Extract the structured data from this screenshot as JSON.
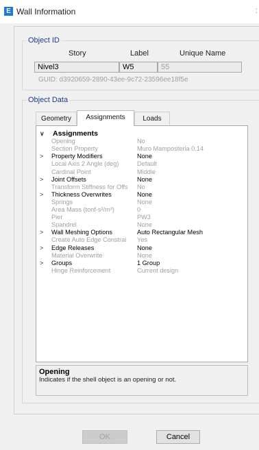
{
  "window": {
    "title": "Wall Information",
    "app_icon": "E"
  },
  "object_id": {
    "group_title": "Object ID",
    "headers": {
      "story": "Story",
      "label": "Label",
      "unique_name": "Unique Name"
    },
    "values": {
      "story": "Nivel3",
      "label": "W5",
      "unique_name": "55"
    },
    "guid": "GUID:  d3920659-2890-43ee-9c72-23596ee18f5e"
  },
  "object_data": {
    "group_title": "Object Data",
    "tabs": [
      {
        "label": "Geometry",
        "active": false
      },
      {
        "label": "Assignments",
        "active": true
      },
      {
        "label": "Loads",
        "active": false
      }
    ],
    "rows": [
      {
        "exp": "v",
        "name": "Assignments",
        "value": "",
        "kind": "head"
      },
      {
        "exp": "",
        "name": "Opening",
        "value": "No",
        "kind": "sub"
      },
      {
        "exp": "",
        "name": "Section Property",
        "value": "Muro Mamposteria 0.14",
        "kind": "sub"
      },
      {
        "exp": ">",
        "name": "Property Modifiers",
        "value": "None",
        "kind": "item"
      },
      {
        "exp": "",
        "name": "Local Axis 2 Angle (deg)",
        "value": "Default",
        "kind": "sub"
      },
      {
        "exp": "",
        "name": "Cardinal Point",
        "value": "Middle",
        "kind": "sub"
      },
      {
        "exp": ">",
        "name": "Joint Offsets",
        "value": "None",
        "kind": "item"
      },
      {
        "exp": "",
        "name": "Transform Stiffness for Offs",
        "value": "No",
        "kind": "sub"
      },
      {
        "exp": ">",
        "name": "Thickness Overwrites",
        "value": "None",
        "kind": "item"
      },
      {
        "exp": "",
        "name": "Springs",
        "value": "None",
        "kind": "sub"
      },
      {
        "exp": "",
        "name": "Area Mass (tonf-s²/m³)",
        "value": "0",
        "kind": "sub"
      },
      {
        "exp": "",
        "name": "Pier",
        "value": "PW3",
        "kind": "sub"
      },
      {
        "exp": "",
        "name": "Spandrel",
        "value": "None",
        "kind": "sub"
      },
      {
        "exp": ">",
        "name": "Wall Meshing Options",
        "value": "Auto Rectangular Mesh",
        "kind": "item"
      },
      {
        "exp": "",
        "name": "Create Auto Edge Constrai",
        "value": "Yes",
        "kind": "sub"
      },
      {
        "exp": ">",
        "name": "Edge Releases",
        "value": "None",
        "kind": "item"
      },
      {
        "exp": "",
        "name": "Material Overwrite",
        "value": "None",
        "kind": "sub"
      },
      {
        "exp": ">",
        "name": "Groups",
        "value": "1 Group",
        "kind": "item"
      },
      {
        "exp": "",
        "name": "Hinge Reinforcement",
        "value": "Current design",
        "kind": "sub"
      }
    ],
    "description": {
      "title": "Opening",
      "text": "Indicates if the shell object is an opening or not."
    }
  },
  "buttons": {
    "ok": "OK",
    "cancel": "Cancel"
  },
  "colors": {
    "accent": "#1c7ad4",
    "group_title": "#1b3c8c",
    "disabled_text": "#a0a0a0"
  }
}
